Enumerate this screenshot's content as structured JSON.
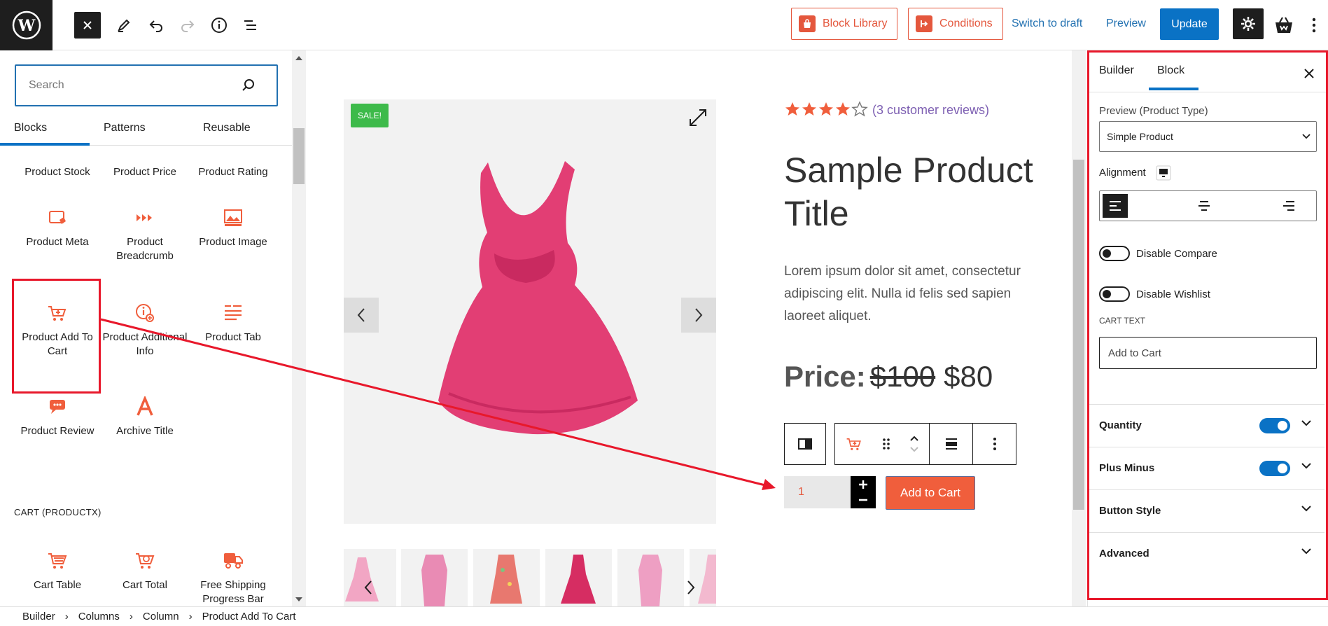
{
  "topbar": {
    "block_library": "Block Library",
    "conditions": "Conditions",
    "switch_to_draft": "Switch to draft",
    "preview": "Preview",
    "update": "Update"
  },
  "left_panel": {
    "search_placeholder": "Search",
    "tabs": [
      "Blocks",
      "Patterns",
      "Reusable"
    ],
    "blocks": [
      {
        "label": "Product Stock",
        "icon": "stock-icon"
      },
      {
        "label": "Product Price",
        "icon": "price-icon"
      },
      {
        "label": "Product Rating",
        "icon": "rating-icon"
      },
      {
        "label": "Product Meta",
        "icon": "meta-icon"
      },
      {
        "label": "Product Breadcrumb",
        "icon": "breadcrumb-icon"
      },
      {
        "label": "Product Image",
        "icon": "image-icon"
      },
      {
        "label": "Product Add To Cart",
        "icon": "add-to-cart-icon"
      },
      {
        "label": "Product Additional Info",
        "icon": "additional-info-icon"
      },
      {
        "label": "Product Tab",
        "icon": "tab-icon"
      },
      {
        "label": "Product Review",
        "icon": "review-icon"
      },
      {
        "label": "Archive Title",
        "icon": "archive-title-icon"
      }
    ],
    "category": "CART (PRODUCTX)",
    "cart_blocks": [
      {
        "label": "Cart Table",
        "icon": "cart-table-icon"
      },
      {
        "label": "Cart Total",
        "icon": "cart-total-icon"
      },
      {
        "label": "Free Shipping Progress Bar",
        "icon": "free-shipping-icon"
      }
    ]
  },
  "canvas": {
    "sale_badge": "SALE!",
    "rating": 4,
    "reviews_text": "(3 customer reviews)",
    "title": "Sample Product Title",
    "description": "Lorem ipsum dolor sit amet, consectetur adipiscing elit. Nulla id felis sed sapien laoreet aliquet.",
    "price_label": "Price:",
    "old_price": "$100",
    "new_price": "$80",
    "quantity": "1",
    "add_to_cart": "Add to Cart"
  },
  "right_panel": {
    "tabs": [
      "Builder",
      "Block"
    ],
    "preview_label": "Preview (Product Type)",
    "preview_value": "Simple Product",
    "alignment_label": "Alignment",
    "disable_compare": "Disable Compare",
    "disable_wishlist": "Disable Wishlist",
    "cart_text_label": "CART TEXT",
    "cart_text_value": "Add to Cart",
    "sections": [
      "Quantity",
      "Plus Minus",
      "Button Style",
      "Advanced"
    ]
  },
  "footer": {
    "breadcrumbs": [
      "Builder",
      "Columns",
      "Column",
      "Product Add To Cart"
    ]
  },
  "colors": {
    "accent": "#f05e3c",
    "primary": "#0a72c5",
    "highlight": "#e8182b"
  }
}
